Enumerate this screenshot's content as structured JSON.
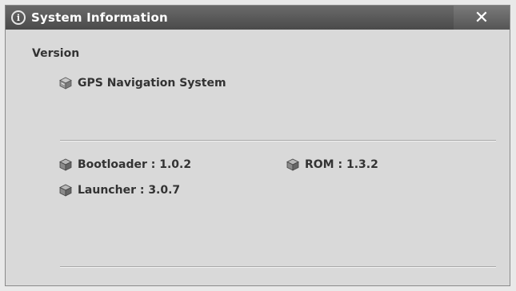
{
  "window": {
    "title": "System Information",
    "info_icon_glyph": "i",
    "close_glyph": "✕"
  },
  "version": {
    "section_label": "Version",
    "product_name": "GPS Navigation System"
  },
  "components": [
    {
      "label": "Bootloader : 1.0.2"
    },
    {
      "label": "ROM : 1.3.2"
    },
    {
      "label": "Launcher : 3.0.7"
    }
  ],
  "icons": {
    "title": "info-icon",
    "product": "box-icon",
    "component": "cube-icon"
  }
}
